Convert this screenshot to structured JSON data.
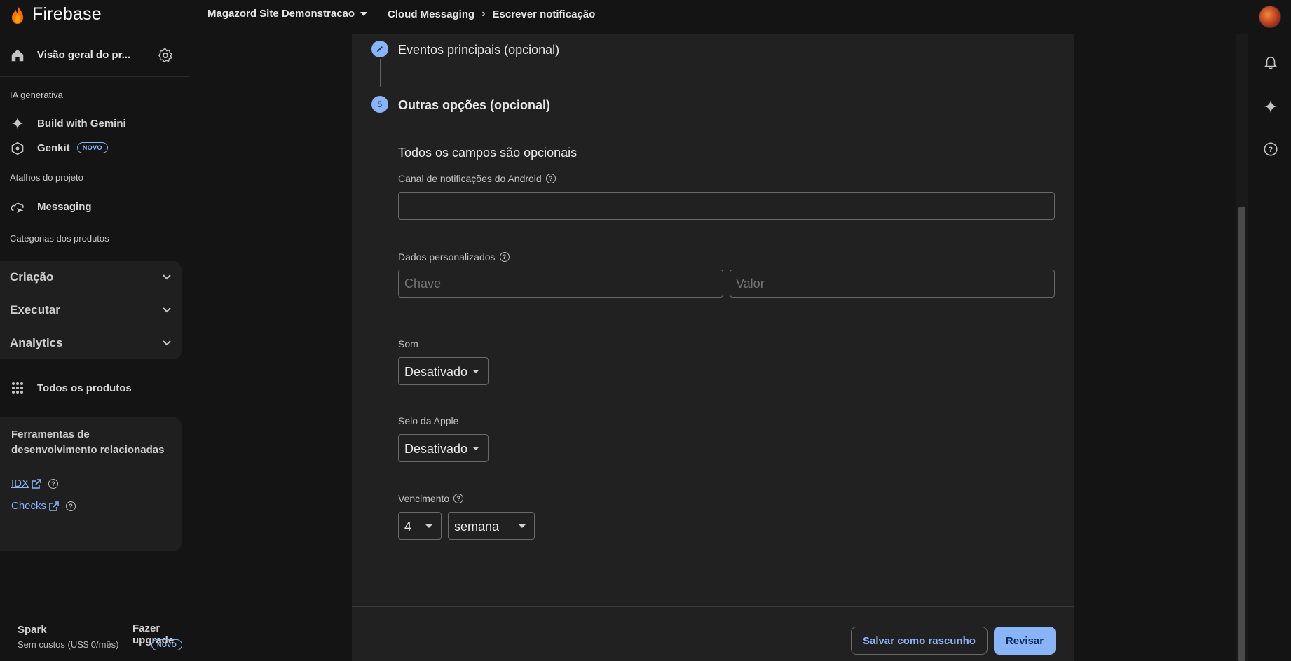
{
  "brand": {
    "name": "Firebase"
  },
  "header": {
    "project": "Magazord Site Demonstracao",
    "breadcrumb": [
      "Cloud Messaging",
      "Escrever notificação"
    ]
  },
  "sidebar": {
    "overview": "Visão geral do pr...",
    "section_ai": "IA generativa",
    "ai_items": [
      {
        "label": "Build with Gemini",
        "icon": "sparkle-icon"
      },
      {
        "label": "Genkit",
        "badge": "NOVO",
        "icon": "genkit-icon"
      }
    ],
    "section_shortcuts": "Atalhos do projeto",
    "shortcut_items": [
      {
        "label": "Messaging",
        "icon": "messaging-icon"
      }
    ],
    "section_categories": "Categorias dos produtos",
    "categories": [
      "Criação",
      "Executar",
      "Analytics"
    ],
    "all_products": "Todos os produtos",
    "tools": {
      "title": "Ferramentas de desenvolvimento relacionadas",
      "links": [
        "IDX",
        "Checks"
      ]
    },
    "plan": {
      "name": "Spark",
      "cost": "Sem custos (US$ 0/mês)",
      "upgrade": "Fazer upgrade",
      "badge": "NOVO"
    }
  },
  "form": {
    "step4": {
      "title": "Eventos principais (opcional)"
    },
    "step5": {
      "number": "5",
      "title": "Outras opções (opcional)"
    },
    "subhead": "Todos os campos são opcionais",
    "android_channel": {
      "label": "Canal de notificações do Android",
      "value": ""
    },
    "custom_data": {
      "label": "Dados personalizados",
      "key_placeholder": "Chave",
      "value_placeholder": "Valor"
    },
    "sound": {
      "label": "Som",
      "value": "Desativado"
    },
    "apple_badge": {
      "label": "Selo da Apple",
      "value": "Desativado"
    },
    "expiration": {
      "label": "Vencimento",
      "amount": "4",
      "unit": "semana"
    }
  },
  "footer": {
    "save_draft": "Salvar como rascunho",
    "review": "Revisar"
  },
  "colors": {
    "accent": "#8ab4f8",
    "background": "#141414",
    "card": "#212121"
  }
}
